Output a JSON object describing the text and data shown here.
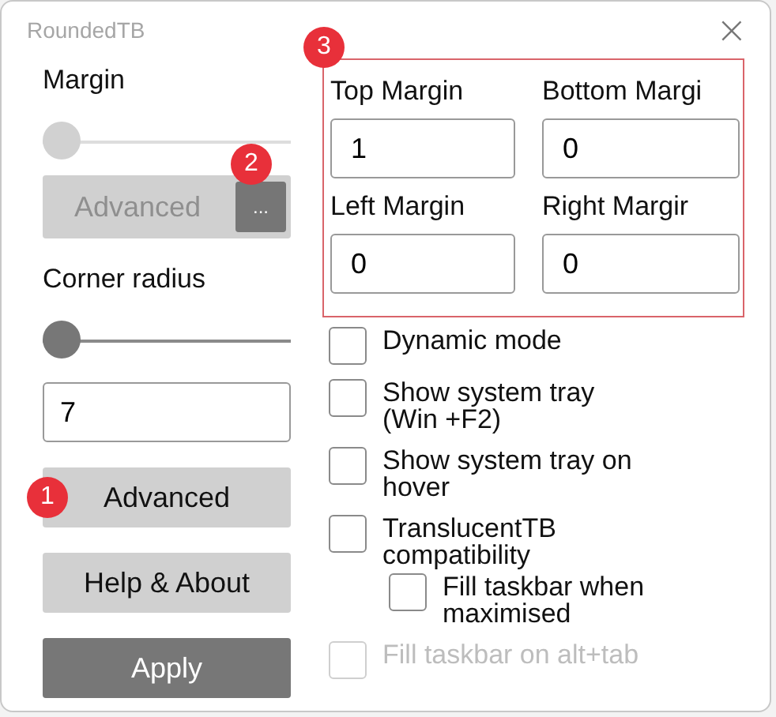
{
  "window": {
    "title": "RoundedTB",
    "close": "×"
  },
  "margin": {
    "label": "Margin",
    "slider": {
      "level": 0,
      "disabled": true
    },
    "advanced_button": {
      "label": "Advanced",
      "disabled": true
    },
    "more_button": {
      "label": "...",
      "badge": "2"
    }
  },
  "corner_radius": {
    "label": "Corner radius",
    "slider": {
      "level": 0,
      "disabled": false
    },
    "value": "7"
  },
  "buttons": [
    {
      "label": "Advanced",
      "kind": "plain",
      "badge": "1"
    },
    {
      "label": "Help & About",
      "kind": "plain"
    },
    {
      "label": "Apply",
      "kind": "primary"
    }
  ],
  "advanced_margins": {
    "badge": "3",
    "fields": [
      {
        "label": "Top Margin",
        "value": "1"
      },
      {
        "label": "Bottom Margi",
        "value": "0"
      },
      {
        "label": "Left Margin",
        "value": "0"
      },
      {
        "label": "Right Margir",
        "value": "0"
      }
    ]
  },
  "options": [
    {
      "label": "Dynamic mode",
      "checked": false,
      "disabled": false
    },
    {
      "label": "Show system tray (Win +F2)",
      "checked": false,
      "disabled": false
    },
    {
      "label": "Show system tray on hover",
      "checked": false,
      "disabled": false
    },
    {
      "label": "TranslucentTB compatibility",
      "checked": false,
      "disabled": false,
      "children": [
        {
          "label": "Fill taskbar when maximised",
          "checked": false,
          "disabled": false
        }
      ]
    },
    {
      "label": "Fill taskbar on alt+tab",
      "checked": false,
      "disabled": true
    }
  ]
}
